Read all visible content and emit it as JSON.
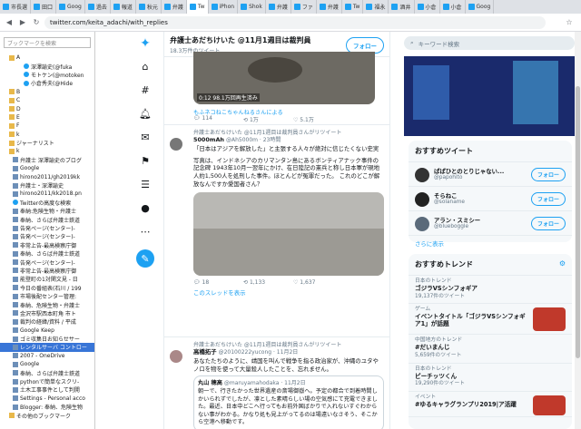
{
  "browser": {
    "tabs": [
      "市長選",
      "田口",
      "Goog",
      "過去",
      "報道",
      "秋元",
      "弁護",
      "Tw",
      "iPhon",
      "Shok",
      "弁護",
      "ファ",
      "弁護",
      "Tw",
      "福永",
      "酒井",
      "小倉",
      "小倉",
      "Goog"
    ],
    "url": "twitter.com/keita_adachi/with_replies"
  },
  "sidebar": {
    "search_placeholder": "ブックマークを検索",
    "items": [
      {
        "label": "A",
        "kind": "folder"
      },
      {
        "label": "深澤諭史(@fuka",
        "kind": "tw"
      },
      {
        "label": "モトケン(@motoken",
        "kind": "tw"
      },
      {
        "label": "小倉秀夫(@Hide",
        "kind": "tw"
      },
      {
        "label": "B",
        "kind": "folder"
      },
      {
        "label": "C",
        "kind": "folder"
      },
      {
        "label": "D",
        "kind": "folder"
      },
      {
        "label": "E",
        "kind": "folder"
      },
      {
        "label": "F",
        "kind": "folder"
      },
      {
        "label": "k",
        "kind": "folder"
      },
      {
        "label": "ジャーナリスト",
        "kind": "folder"
      },
      {
        "label": "k",
        "kind": "folder"
      },
      {
        "label": "弁護士 深澤諭史のブログ",
        "kind": "pg"
      },
      {
        "label": "Google",
        "kind": "pg"
      },
      {
        "label": "hirono2011/gh2019kk",
        "kind": "pg"
      },
      {
        "label": "弁護士・深澤諭史",
        "kind": "pg"
      },
      {
        "label": "hirono2011/kk2018.pn",
        "kind": "pg"
      },
      {
        "label": "Twitterの高度な検索",
        "kind": "tw"
      },
      {
        "label": "奉納:危険生物・弁護士",
        "kind": "pg"
      },
      {
        "label": "奉納、さらば弁護士鉄道",
        "kind": "pg"
      },
      {
        "label": "告発ページ(センター)-",
        "kind": "pg"
      },
      {
        "label": "告発ページ(センター)-",
        "kind": "pg"
      },
      {
        "label": "非常上告-最高検察庁御",
        "kind": "pg"
      },
      {
        "label": "奉納、さらば弁護士鉄道",
        "kind": "pg"
      },
      {
        "label": "告発ページ(センター)-",
        "kind": "pg"
      },
      {
        "label": "非常上告-最高検察庁御",
        "kind": "pg"
      },
      {
        "label": "能登町の1対関文見 - 日",
        "kind": "pg"
      },
      {
        "label": "今日の番組表(石川 / 199",
        "kind": "pg"
      },
      {
        "label": "市場後配センター管理:",
        "kind": "pg"
      },
      {
        "label": "奉納、危険生物・弁護士",
        "kind": "pg"
      },
      {
        "label": "金沢市駅西本町角 市ト",
        "kind": "pg"
      },
      {
        "label": "裁判の経緯/資料 / 平成",
        "kind": "pg"
      },
      {
        "label": "Google Keep",
        "kind": "pg"
      },
      {
        "label": "ゴミ収集日お知らせサー",
        "kind": "pg"
      },
      {
        "label": "レンタルサーバ コントロー",
        "kind": "pg",
        "hl": true
      },
      {
        "label": "2007 - OneDrive",
        "kind": "pg"
      },
      {
        "label": "Google",
        "kind": "pg"
      },
      {
        "label": "奉納、さらば弁護士鉄道",
        "kind": "pg"
      },
      {
        "label": "pythonで簡単なスクリ-",
        "kind": "pg"
      },
      {
        "label": "土木工事事件として判開",
        "kind": "pg"
      },
      {
        "label": "Settings - Personal acco",
        "kind": "pg"
      },
      {
        "label": "Blogger: 奉納、危険生物",
        "kind": "pg"
      },
      {
        "label": "その他のブックマーク",
        "kind": "folder"
      }
    ]
  },
  "feed": {
    "header_title": "弁護士あだちけいた @11月1週目は裁判員",
    "header_sub": "18.3万件のツイート",
    "follow_label": "フォロー",
    "video_caption": "0:12   98.1万回再生済み",
    "video_by": "もふネコねこちゃんねるさんによる",
    "t0_actions": [
      "114",
      "1万",
      "5.1万"
    ],
    "t1_retweet": "弁護士あだちけいた @11月1週目は裁判員さんがリツイート",
    "t1_name": "5000mAh",
    "t1_handle": "@Ah5000m · 23時間",
    "t1_line1": "「日本はアジアを解放した」と主張する人々が絶対に信じたくない史実",
    "t1_body": "写真は、インドネシアのカリマンタン島にあるボンティアナック事件の記念碑 1943年10月一翌年にかけ、在日陸記の憲兵と称し日本軍が現地人約1,500人を処刑した事件。ほとんどが冤罪だった。 これのどこが解放なんですか愛国者さん？",
    "t1_actions": [
      "18",
      "1,133",
      "1,637"
    ],
    "t1_thread": "このスレッドを表示",
    "t2_retweet": "弁護士あだちけいた @11月1週目は裁判員さんがリツイート",
    "t2_name": "高橋拓子",
    "t2_handle": "@20100222yucong · 11月2日",
    "t2_body": "あなたたちのように、靖国を叫んで戦争を指る政治家が、沖縄のユタやノロを物を使って大量殺人したことを、忘れません。",
    "t2_quote_name": "丸山 穂高",
    "t2_quote_handle": "@maruyamahodaka · 11月2日",
    "t2_quote_body": "朝一で、行きたかった世界遺産の斎場御嶽へ。予定の都合で到着時間しかいられずでしたが、凛とした素晴らしい場の空気感にて充電できました。最近、日本中どこへ行ってもお前外国ばかりで入れないすぐわからない事がわかる。かなり処も見上がってるのは場遠いなさそう、そこから空港へ移動です。"
  },
  "right": {
    "search_placeholder": "キーワード検索",
    "who_title": "おすすめツイート",
    "accounts": [
      {
        "name": "ぱぱひとのとりじゃない...",
        "handle": "@papohito",
        "btn": "フォロー"
      },
      {
        "name": "そらねこ",
        "handle": "@solaname",
        "btn": "フォロー"
      },
      {
        "name": "アラン・スミシー",
        "handle": "@blueboggle",
        "btn": "フォロー"
      }
    ],
    "more": "さらに表示",
    "trends_title": "おすすめトレンド",
    "trends": [
      {
        "ctx": "日本のトレンド",
        "name": "ゴジラVSシンフォギア",
        "count": "19,137件のツイート"
      },
      {
        "ctx": "ゲーム",
        "name": "イベントタイトル「ゴジラVSシンフォギア1」が話題",
        "count": ""
      },
      {
        "ctx": "中国地方のトレンド",
        "name": "#だいまんじ",
        "count": "5,659件のツイート"
      },
      {
        "ctx": "日本のトレンド",
        "name": "ピーチッツくん",
        "count": "19,290件のツイート"
      },
      {
        "ctx": "イベント",
        "name": "#ゆるキャラグランプリ2019|ア活躍",
        "count": ""
      }
    ]
  },
  "colors": {
    "accent": "#1da1f2"
  }
}
